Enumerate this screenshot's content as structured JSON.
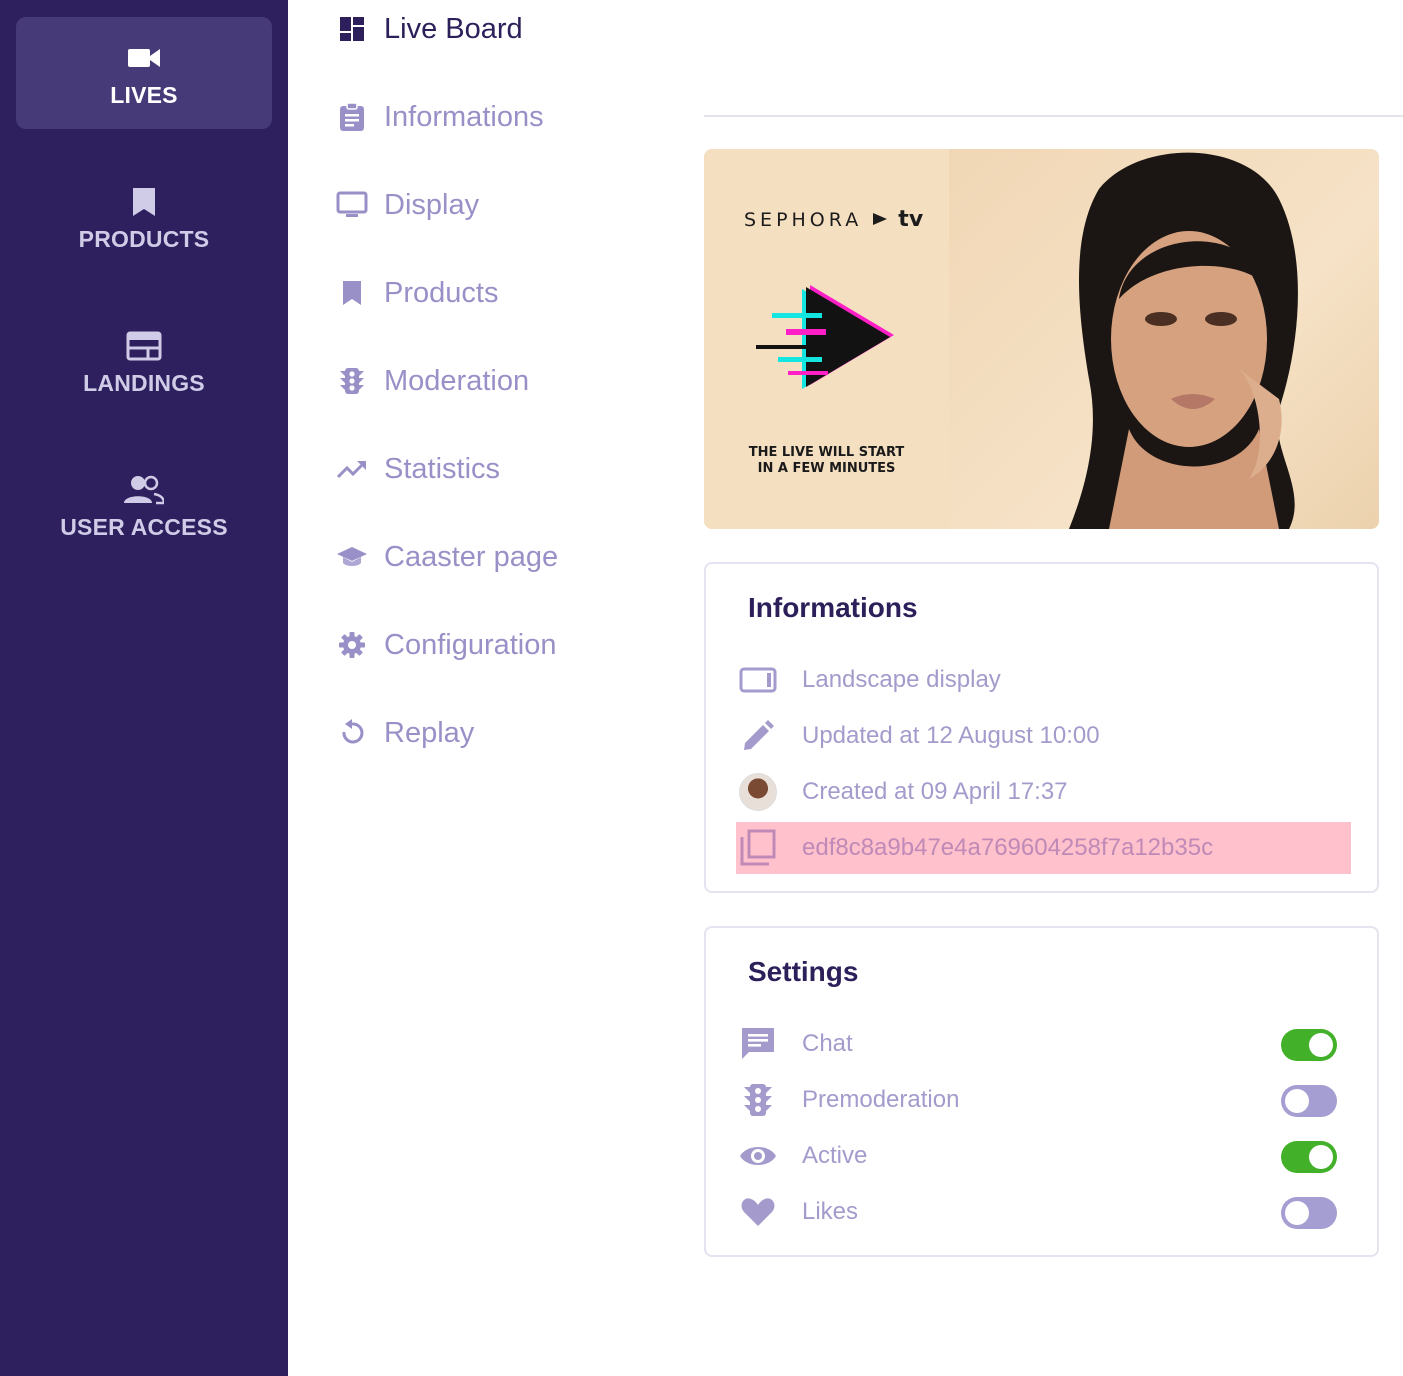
{
  "rail": {
    "items": [
      {
        "label": "LIVES",
        "icon": "video-camera-icon",
        "active": true
      },
      {
        "label": "PRODUCTS",
        "icon": "bookmark-icon",
        "active": false
      },
      {
        "label": "LANDINGS",
        "icon": "web-window-icon",
        "active": false
      },
      {
        "label": "USER ACCESS",
        "icon": "people-icon",
        "active": false
      }
    ]
  },
  "subnav": {
    "items": [
      {
        "label": "Live Board",
        "icon": "dashboard-icon",
        "active": true
      },
      {
        "label": "Informations",
        "icon": "clipboard-icon",
        "active": false
      },
      {
        "label": "Display",
        "icon": "monitor-icon",
        "active": false
      },
      {
        "label": "Products",
        "icon": "bookmark-icon",
        "active": false
      },
      {
        "label": "Moderation",
        "icon": "traffic-light-icon",
        "active": false
      },
      {
        "label": "Statistics",
        "icon": "trending-up-icon",
        "active": false
      },
      {
        "label": "Caaster page",
        "icon": "graduation-cap-icon",
        "active": false
      },
      {
        "label": "Configuration",
        "icon": "gear-icon",
        "active": false
      },
      {
        "label": "Replay",
        "icon": "replay-icon",
        "active": false
      }
    ]
  },
  "preview": {
    "brand": "SEPHORA",
    "brand_tv": "tv",
    "message_line1": "THE LIVE WILL START",
    "message_line2": "IN A FEW MINUTES"
  },
  "informations": {
    "title": "Informations",
    "rows": [
      {
        "icon": "landscape-icon",
        "text": "Landscape display"
      },
      {
        "icon": "pencil-icon",
        "text": "Updated at 12 August 10:00"
      },
      {
        "icon": "avatar",
        "text": "Created at 09 April 17:37"
      },
      {
        "icon": "copy-icon",
        "text": "edf8c8a9b47e4a769604258f7a12b35c"
      }
    ]
  },
  "settings": {
    "title": "Settings",
    "rows": [
      {
        "icon": "chat-icon",
        "text": "Chat",
        "enabled": true
      },
      {
        "icon": "traffic-light-icon",
        "text": "Premoderation",
        "enabled": false
      },
      {
        "icon": "eye-icon",
        "text": "Active",
        "enabled": true
      },
      {
        "icon": "heart-icon",
        "text": "Likes",
        "enabled": false
      }
    ]
  },
  "colors": {
    "rail_bg": "#2e1f5e",
    "rail_active": "#473a78",
    "accent_text": "#2c1f5a",
    "muted_text": "#9a90c8",
    "toggle_on": "#43b02a",
    "toggle_off": "#a59ed2",
    "highlight": "#ffc1cb"
  }
}
